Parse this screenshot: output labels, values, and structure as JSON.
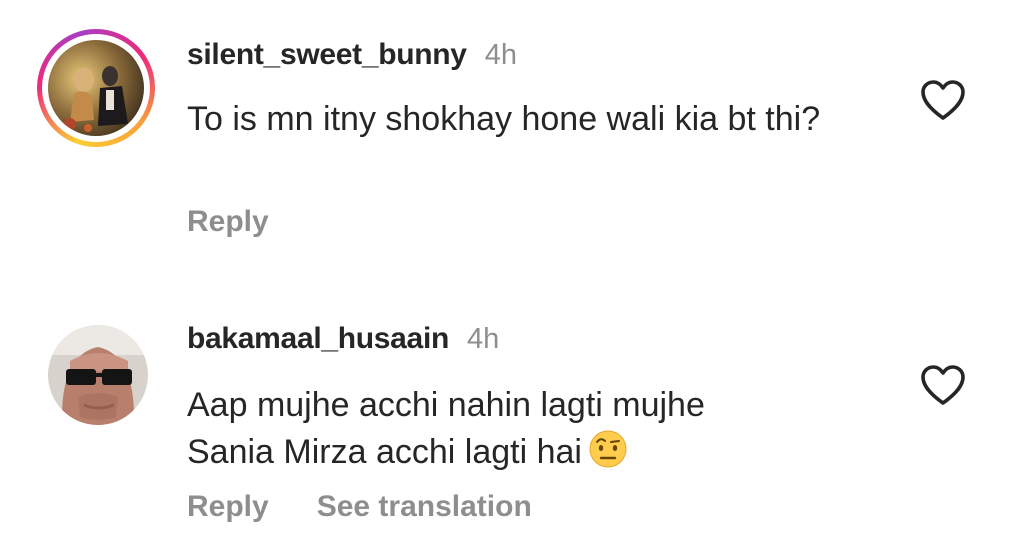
{
  "comments": [
    {
      "username": "silent_sweet_bunny",
      "time": "4h",
      "text": "To is mn itny shokhay hone wali kia bt thi?",
      "reply_label": "Reply",
      "has_story_ring": true,
      "like_icon": "heart-outline-icon"
    },
    {
      "username": "bakamaal_husaain",
      "time": "4h",
      "text_line1": "Aap mujhe acchi nahin lagti mujhe",
      "text_line2": "Sania Mirza acchi lagti hai",
      "emoji": "face-with-raised-eyebrow-emoji",
      "reply_label": "Reply",
      "translate_label": "See translation",
      "like_icon": "heart-outline-icon"
    }
  ],
  "colors": {
    "text_primary": "#262626",
    "text_secondary": "#8e8e8e",
    "background": "#ffffff"
  }
}
